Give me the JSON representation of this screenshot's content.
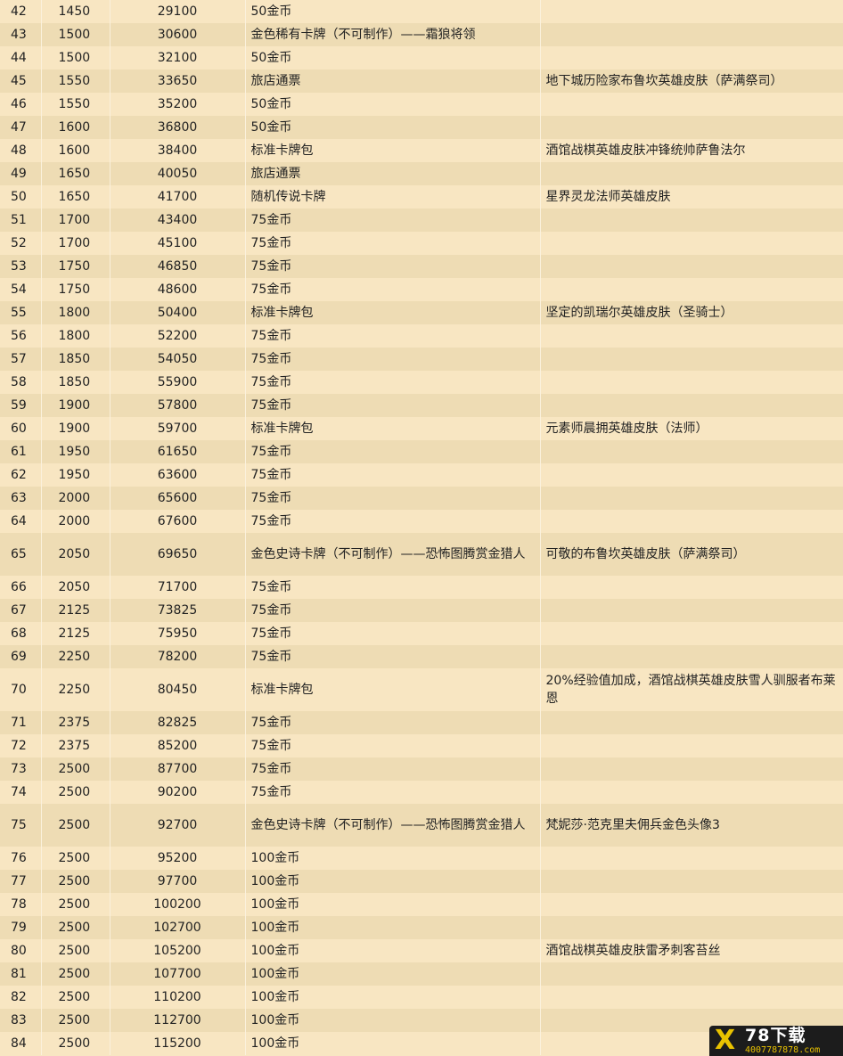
{
  "rows": [
    {
      "level": "42",
      "xp": "1450",
      "total": "29100",
      "reward": "50金币",
      "extra": ""
    },
    {
      "level": "43",
      "xp": "1500",
      "total": "30600",
      "reward": "金色稀有卡牌（不可制作）——霜狼将领",
      "extra": ""
    },
    {
      "level": "44",
      "xp": "1500",
      "total": "32100",
      "reward": "50金币",
      "extra": ""
    },
    {
      "level": "45",
      "xp": "1550",
      "total": "33650",
      "reward": "旅店通票",
      "extra": "地下城历险家布鲁坎英雄皮肤（萨满祭司）"
    },
    {
      "level": "46",
      "xp": "1550",
      "total": "35200",
      "reward": "50金币",
      "extra": ""
    },
    {
      "level": "47",
      "xp": "1600",
      "total": "36800",
      "reward": "50金币",
      "extra": ""
    },
    {
      "level": "48",
      "xp": "1600",
      "total": "38400",
      "reward": "标准卡牌包",
      "extra": "酒馆战棋英雄皮肤冲锋统帅萨鲁法尔"
    },
    {
      "level": "49",
      "xp": "1650",
      "total": "40050",
      "reward": "旅店通票",
      "extra": ""
    },
    {
      "level": "50",
      "xp": "1650",
      "total": "41700",
      "reward": "随机传说卡牌",
      "extra": "星界灵龙法师英雄皮肤"
    },
    {
      "level": "51",
      "xp": "1700",
      "total": "43400",
      "reward": "75金币",
      "extra": ""
    },
    {
      "level": "52",
      "xp": "1700",
      "total": "45100",
      "reward": "75金币",
      "extra": ""
    },
    {
      "level": "53",
      "xp": "1750",
      "total": "46850",
      "reward": "75金币",
      "extra": ""
    },
    {
      "level": "54",
      "xp": "1750",
      "total": "48600",
      "reward": "75金币",
      "extra": ""
    },
    {
      "level": "55",
      "xp": "1800",
      "total": "50400",
      "reward": "标准卡牌包",
      "extra": "坚定的凯瑞尔英雄皮肤（圣骑士）"
    },
    {
      "level": "56",
      "xp": "1800",
      "total": "52200",
      "reward": "75金币",
      "extra": ""
    },
    {
      "level": "57",
      "xp": "1850",
      "total": "54050",
      "reward": "75金币",
      "extra": ""
    },
    {
      "level": "58",
      "xp": "1850",
      "total": "55900",
      "reward": "75金币",
      "extra": ""
    },
    {
      "level": "59",
      "xp": "1900",
      "total": "57800",
      "reward": "75金币",
      "extra": ""
    },
    {
      "level": "60",
      "xp": "1900",
      "total": "59700",
      "reward": "标准卡牌包",
      "extra": "元素师晨拥英雄皮肤（法师）"
    },
    {
      "level": "61",
      "xp": "1950",
      "total": "61650",
      "reward": "75金币",
      "extra": ""
    },
    {
      "level": "62",
      "xp": "1950",
      "total": "63600",
      "reward": "75金币",
      "extra": ""
    },
    {
      "level": "63",
      "xp": "2000",
      "total": "65600",
      "reward": "75金币",
      "extra": ""
    },
    {
      "level": "64",
      "xp": "2000",
      "total": "67600",
      "reward": "75金币",
      "extra": ""
    },
    {
      "level": "65",
      "xp": "2050",
      "total": "69650",
      "reward": "金色史诗卡牌（不可制作）——恐怖图腾赏金猎人",
      "extra": "可敬的布鲁坎英雄皮肤（萨满祭司）"
    },
    {
      "level": "66",
      "xp": "2050",
      "total": "71700",
      "reward": "75金币",
      "extra": ""
    },
    {
      "level": "67",
      "xp": "2125",
      "total": "73825",
      "reward": "75金币",
      "extra": ""
    },
    {
      "level": "68",
      "xp": "2125",
      "total": "75950",
      "reward": "75金币",
      "extra": ""
    },
    {
      "level": "69",
      "xp": "2250",
      "total": "78200",
      "reward": "75金币",
      "extra": ""
    },
    {
      "level": "70",
      "xp": "2250",
      "total": "80450",
      "reward": "标准卡牌包",
      "extra": "20%经验值加成，酒馆战棋英雄皮肤雪人驯服者布莱恩"
    },
    {
      "level": "71",
      "xp": "2375",
      "total": "82825",
      "reward": "75金币",
      "extra": ""
    },
    {
      "level": "72",
      "xp": "2375",
      "total": "85200",
      "reward": "75金币",
      "extra": ""
    },
    {
      "level": "73",
      "xp": "2500",
      "total": "87700",
      "reward": "75金币",
      "extra": ""
    },
    {
      "level": "74",
      "xp": "2500",
      "total": "90200",
      "reward": "75金币",
      "extra": ""
    },
    {
      "level": "75",
      "xp": "2500",
      "total": "92700",
      "reward": "金色史诗卡牌（不可制作）——恐怖图腾赏金猎人",
      "extra": "梵妮莎·范克里夫佣兵金色头像3"
    },
    {
      "level": "76",
      "xp": "2500",
      "total": "95200",
      "reward": "100金币",
      "extra": ""
    },
    {
      "level": "77",
      "xp": "2500",
      "total": "97700",
      "reward": "100金币",
      "extra": ""
    },
    {
      "level": "78",
      "xp": "2500",
      "total": "100200",
      "reward": "100金币",
      "extra": ""
    },
    {
      "level": "79",
      "xp": "2500",
      "total": "102700",
      "reward": "100金币",
      "extra": ""
    },
    {
      "level": "80",
      "xp": "2500",
      "total": "105200",
      "reward": "100金币",
      "extra": "酒馆战棋英雄皮肤雷矛刺客苔丝"
    },
    {
      "level": "81",
      "xp": "2500",
      "total": "107700",
      "reward": "100金币",
      "extra": ""
    },
    {
      "level": "82",
      "xp": "2500",
      "total": "110200",
      "reward": "100金币",
      "extra": ""
    },
    {
      "level": "83",
      "xp": "2500",
      "total": "112700",
      "reward": "100金币",
      "extra": ""
    },
    {
      "level": "84",
      "xp": "2500",
      "total": "115200",
      "reward": "100金币",
      "extra": ""
    }
  ],
  "watermark": {
    "mark": "X",
    "title": "78下载",
    "phone": "4007787878.com"
  }
}
